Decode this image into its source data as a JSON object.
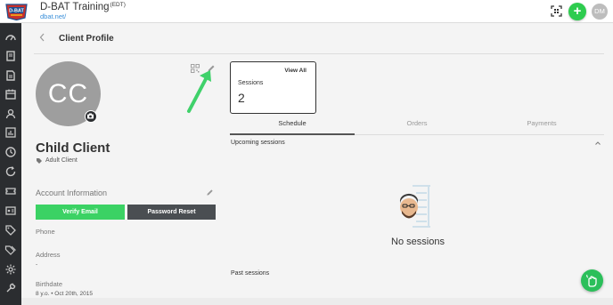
{
  "app": {
    "brand_name": "D-BAT Training",
    "brand_suffix": "(EDT)",
    "brand_url": "dbat.net/",
    "logo_text": "D-BAT",
    "user_initials": "DM",
    "plus_label": "+"
  },
  "sidebar": {
    "items": [
      {
        "icon": "dashboard-icon"
      },
      {
        "icon": "book-icon"
      },
      {
        "icon": "document-icon"
      },
      {
        "icon": "calendar-icon"
      },
      {
        "icon": "clients-icon"
      },
      {
        "icon": "reports-icon"
      },
      {
        "icon": "clock-icon"
      },
      {
        "icon": "refresh-icon"
      },
      {
        "icon": "ticket-icon"
      },
      {
        "icon": "id-card-icon"
      },
      {
        "icon": "tag-icon"
      },
      {
        "icon": "tags-icon"
      },
      {
        "icon": "settings-icon"
      },
      {
        "icon": "tools-icon"
      }
    ]
  },
  "page": {
    "title": "Client Profile"
  },
  "profile": {
    "initials": "CC",
    "name": "Child Client",
    "type": "Adult Client"
  },
  "account": {
    "title": "Account Information",
    "verify_label": "Verify Email",
    "reset_label": "Password Reset",
    "fields": [
      {
        "label": "Phone",
        "value": ""
      },
      {
        "label": "Address",
        "value": "-"
      },
      {
        "label": "Birthdate",
        "value": "8 y.o. • Oct 20th, 2015"
      }
    ]
  },
  "sessions_card": {
    "view_all": "View All",
    "label": "Sessions",
    "count": "2"
  },
  "tabs": [
    {
      "label": "Schedule",
      "active": true
    },
    {
      "label": "Orders",
      "active": false
    },
    {
      "label": "Payments",
      "active": false
    }
  ],
  "schedule": {
    "upcoming_label": "Upcoming sessions",
    "empty_message": "No sessions",
    "past_label": "Past sessions"
  },
  "colors": {
    "accent_green": "#2ecc4f",
    "verify_green": "#3bd264",
    "sidebar_dark": "#2b2d30",
    "annotation_arrow": "#3fd16a"
  }
}
